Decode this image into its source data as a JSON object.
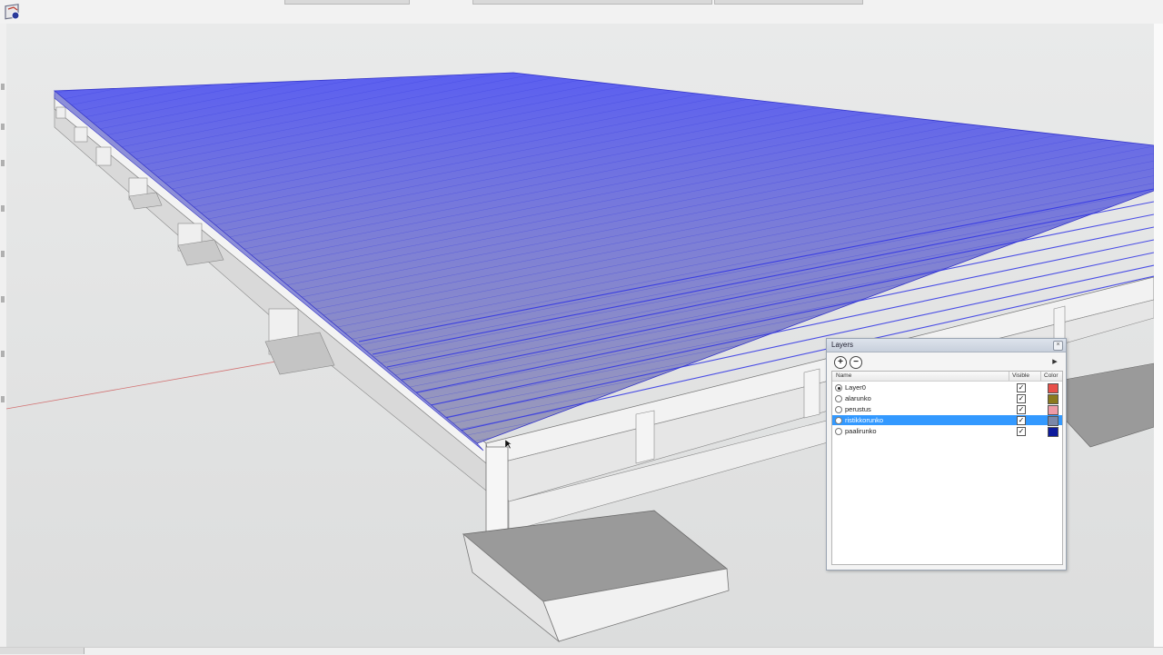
{
  "app": {
    "icon": "sketchup-app-icon"
  },
  "layers_panel": {
    "title": "Layers",
    "close_glyph": "×",
    "add_glyph": "+",
    "remove_glyph": "−",
    "details_glyph": "▸",
    "columns": {
      "name": "Name",
      "visible": "Visible",
      "color": "Color"
    },
    "layers": [
      {
        "name": "Layer0",
        "active": true,
        "visible": true,
        "color": "#e8504a",
        "selected": false
      },
      {
        "name": "alarunko",
        "active": false,
        "visible": true,
        "color": "#8a7a1e",
        "selected": false
      },
      {
        "name": "perustus",
        "active": false,
        "visible": true,
        "color": "#ee9aa6",
        "selected": false
      },
      {
        "name": "ristikkorunko",
        "active": false,
        "visible": true,
        "color": "#7b87a8",
        "selected": true
      },
      {
        "name": "paalirunko",
        "active": false,
        "visible": true,
        "color": "#0d1a9c",
        "selected": false
      }
    ]
  },
  "model": {
    "deck_highlight_color": "#4f55ff",
    "structure_color": "#ececec",
    "shadow_color": "#8f8f8f"
  }
}
